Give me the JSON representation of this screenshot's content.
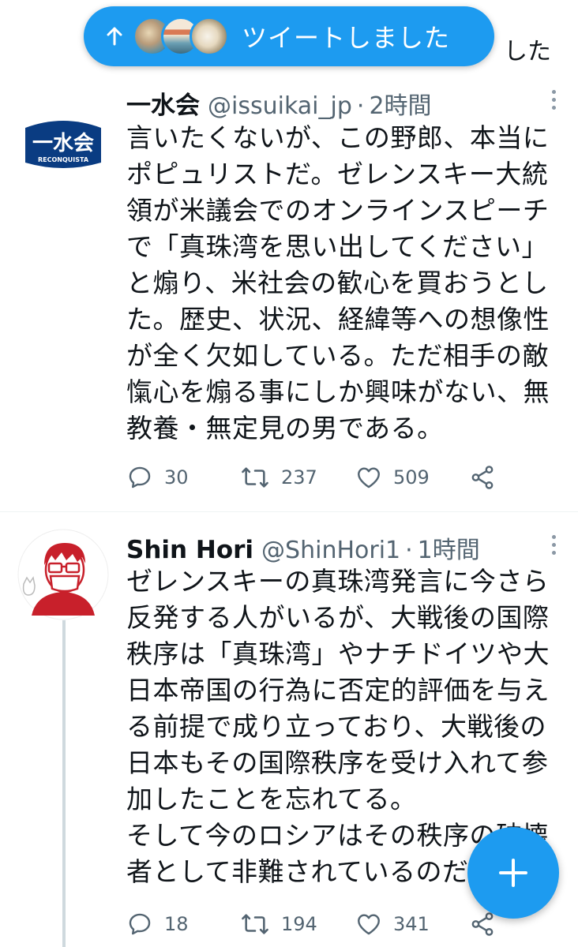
{
  "colors": {
    "accent": "#1d9bf0",
    "text_primary": "#0f1419",
    "text_secondary": "#536471",
    "avatar_issuikai_bg": "#0a3c82",
    "avatar_shin_red": "#c8202b"
  },
  "partial_header_text": "した",
  "new_tweets_pill": {
    "label": "ツイートしました",
    "arrow_icon": "arrow-up-icon"
  },
  "tweets": [
    {
      "name": "一水会",
      "handle": "@issuikai_jp",
      "separator": "·",
      "time": "2時間",
      "avatar_text": "一水会",
      "avatar_subtext": "RECONQUISTA",
      "body": "言いたくないが、この野郎、本当に\nポピュリストだ。ゼレンスキー大統\n領が米議会でのオンラインスピーチ\nで「真珠湾を思い出してください」\nと煽り、米社会の歓心を買おうとし\nた。歴史、状況、経緯等への想像性\nが全く欠如している。ただ相手の敵\n愾心を煽る事にしか興味がない、無\n教養・無定見の男である。",
      "replies": "30",
      "retweets": "237",
      "likes": "509"
    },
    {
      "name": "Shin Hori",
      "handle": "@ShinHori1",
      "separator": "·",
      "time": "1時間",
      "body": "ゼレンスキーの真珠湾発言に今さら\n反発する人がいるが、大戦後の国際\n秩序は「真珠湾」やナチドイツや大\n日本帝国の行為に否定的評価を与え\nる前提で成り立っており、大戦後の\n日本もその国際秩序を受け入れて参\n加したことを忘れてる。\nそして今のロシアはその秩序の破壊\n者として非難されているのだ",
      "replies": "18",
      "retweets": "194",
      "likes": "341"
    }
  ],
  "icons": {
    "reply": "reply-icon",
    "retweet": "retweet-icon",
    "like": "heart-icon",
    "share": "share-icon",
    "more": "more-dots-icon",
    "compose": "plus-icon"
  }
}
